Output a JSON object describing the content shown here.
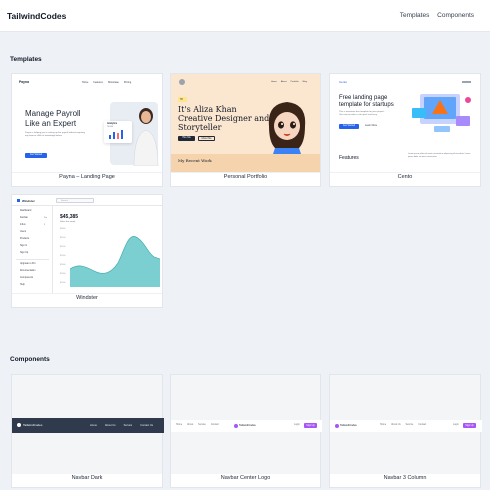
{
  "header": {
    "brand": "TailwindCodes",
    "nav": [
      "Templates",
      "Components"
    ]
  },
  "sections": {
    "templates": "Templates",
    "components": "Components"
  },
  "templates": [
    {
      "caption": "Payna – Landing Page",
      "logo": "Payna",
      "nav": [
        "Home",
        "Features",
        "Showcase",
        "Pricing"
      ],
      "headline1": "Manage Payroll",
      "headline2": "Like an Expert",
      "body": "Payna is helping you in setting up the payroll without requiring any finance skills or knowledge before",
      "cta": "Get Started",
      "analytics_label": "Analytics",
      "analytics_value": "78,000"
    },
    {
      "caption": "Personal Portfolio",
      "nav": [
        "Home",
        "About",
        "Portfolio",
        "Blog"
      ],
      "greeting": "Hi!",
      "line1": "It's Aliza Khan",
      "line2": "Creative Designer and",
      "line3": "Storyteller",
      "btn1": "Hire Me",
      "btn2": "About Me",
      "work_title": "My Recent Work"
    },
    {
      "caption": "Cento",
      "logo": "Cento",
      "headline1": "Free landing page",
      "headline2": "template for startups",
      "body": "This is awesome free template for your project. Use now to make a site quick and easy.",
      "btn1": "Get Started",
      "btn2": "Learn More",
      "features_title": "Features",
      "features_text": "Lorem ipsum dolor sit amet consectetur adipiscing elit tincidunt. Lorem ipsum dolor sit amet consectetur."
    },
    {
      "caption": "Windster",
      "logo": "Windster",
      "search_placeholder": "Search",
      "menu": [
        "Dashboard",
        "Kanban",
        "Inbox",
        "Users",
        "Products",
        "Sign In",
        "Sign Up",
        "Upgrade to Pro",
        "Documentation",
        "Components",
        "Help"
      ],
      "menu_badges": [
        "",
        "Pro",
        "3",
        "",
        "",
        "",
        "",
        "",
        "",
        "",
        ""
      ],
      "stat_value": "$45,385",
      "stat_label": "Sales this week",
      "y_ticks": [
        "$6800",
        "$6500",
        "$6200",
        "$5900",
        "$5600",
        "$5300",
        "$5000"
      ]
    }
  ],
  "components": [
    {
      "caption": "Navbar Dark",
      "brand": "TailwindCodes",
      "links": [
        "Home",
        "About Us",
        "Service",
        "Contact Us"
      ]
    },
    {
      "caption": "Navbar Center Logo",
      "brand": "TailwindCodes",
      "links": [
        "Home",
        "About",
        "Service",
        "Contact"
      ],
      "right_link": "Login",
      "right_btn": "Sign Up"
    },
    {
      "caption": "Navbar 3 Column",
      "brand": "TailwindCodes",
      "links": [
        "Home",
        "About Us",
        "Service",
        "Contact"
      ],
      "right_link": "Login",
      "right_btn": "Sign Up"
    }
  ],
  "colors": {
    "accent": "#2563eb",
    "teal": "#7ccfd0",
    "portfolio_bg": "#fbe7cf",
    "dark_nav": "#2f3b4d",
    "purple": "#a855f7"
  }
}
